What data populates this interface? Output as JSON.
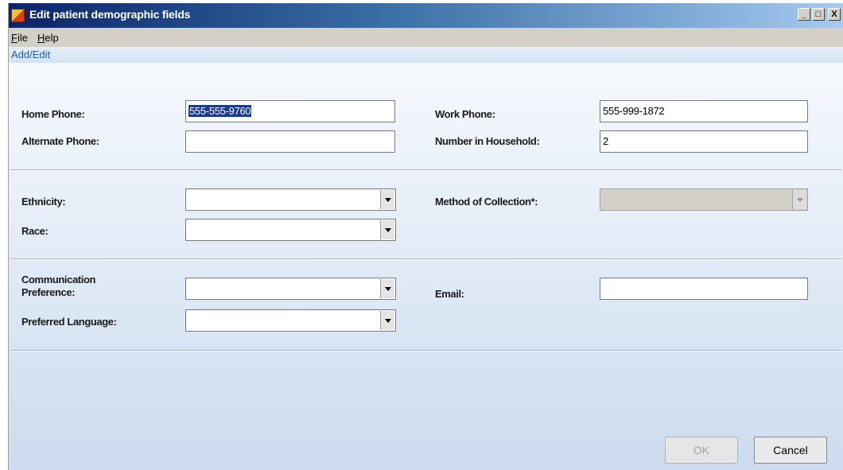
{
  "window": {
    "title": "Edit patient demographic fields",
    "buttons": {
      "minimize": "_",
      "maximize": "□",
      "close": "X"
    }
  },
  "menu": {
    "file": {
      "mnemonic": "F",
      "rest": "ile"
    },
    "help": {
      "mnemonic": "H",
      "rest": "elp"
    }
  },
  "toolstrip": {
    "label": "Add/Edit"
  },
  "form": {
    "home_phone": {
      "label": "Home Phone:",
      "value": "555-555-9760",
      "selected": true
    },
    "work_phone": {
      "label": "Work Phone:",
      "value": "555-999-1872"
    },
    "alternate_phone": {
      "label": "Alternate Phone:",
      "value": ""
    },
    "number_in_household": {
      "label": "Number in Household:",
      "value": "2"
    },
    "ethnicity": {
      "label": "Ethnicity:",
      "value": ""
    },
    "method_of_collection": {
      "label": "Method of Collection*:",
      "value": "",
      "enabled": false
    },
    "race": {
      "label": "Race:",
      "value": ""
    },
    "communication_preference": {
      "label_line1": "Communication",
      "label_line2": "Preference:",
      "value": ""
    },
    "email": {
      "label": "Email:",
      "value": ""
    },
    "preferred_language": {
      "label": "Preferred Language:",
      "value": ""
    }
  },
  "buttons": {
    "ok": {
      "label": "OK",
      "enabled": false
    },
    "cancel": {
      "label": "Cancel",
      "enabled": true
    }
  }
}
